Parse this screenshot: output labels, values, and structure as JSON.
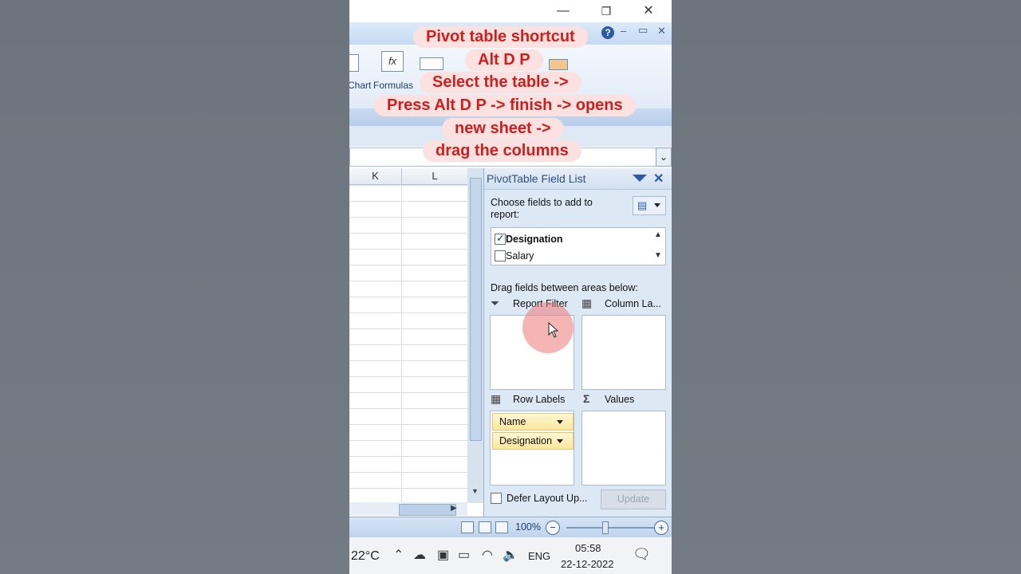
{
  "colors": {
    "annotation_text": "#cc1f1f",
    "annotation_bg": "#fbe1df",
    "pane_title": "#2f4f7f",
    "chip_bg": "#fde79a"
  },
  "window": {
    "minimize_icon": "—",
    "restore_icon": "❐",
    "close_icon": "✕"
  },
  "ribbon": {
    "chart_label": "Chart",
    "formulas_label": "Formulas",
    "help_icon": "?",
    "min_icon": "–",
    "restore_icon": "▭",
    "close_icon": "✕"
  },
  "grid": {
    "columns": [
      "K",
      "L"
    ]
  },
  "pivot": {
    "title": "PivotTable Field List",
    "choose_label": "Choose fields to add to",
    "choose_label2": "report:",
    "fields": [
      {
        "name": "Designation",
        "checked": true
      },
      {
        "name": "Salary",
        "checked": false
      }
    ],
    "drag_label": "Drag fields between areas below:",
    "report_filter": "Report Filter",
    "column_labels": "Column La...",
    "row_labels": "Row Labels",
    "values": "Values",
    "row_items": [
      "Name",
      "Designation"
    ],
    "defer_label": "Defer Layout Up...",
    "update_label": "Update"
  },
  "status": {
    "zoom": "100%"
  },
  "taskbar": {
    "temperature": "22°C",
    "language": "ENG",
    "time": "05:58",
    "date": "22-12-2022"
  },
  "annotation": {
    "lines": [
      "Pivot table shortcut",
      "Alt D P",
      "Select the table ->",
      "Press Alt D P -> finish -> opens",
      "new sheet ->",
      "drag the columns"
    ]
  }
}
